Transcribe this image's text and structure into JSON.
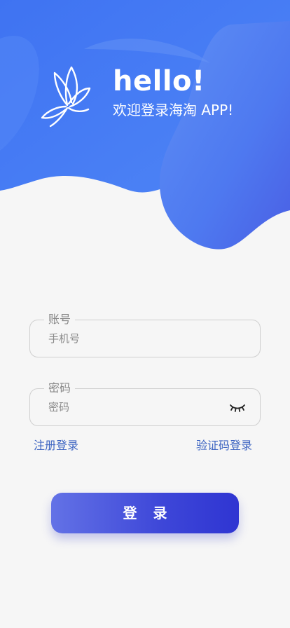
{
  "header": {
    "hello": "hello!",
    "welcome": "欢迎登录海淘 APP!"
  },
  "form": {
    "account": {
      "legend": "账号",
      "placeholder": "手机号",
      "value": ""
    },
    "password": {
      "legend": "密码",
      "placeholder": "密码",
      "value": "",
      "toggle_icon": "eye-closed-icon"
    }
  },
  "links": {
    "register_login": "注册登录",
    "code_login": "验证码登录"
  },
  "login_button": {
    "label": "登 录"
  },
  "colors": {
    "header_blue": "#4f7ef3",
    "link_blue": "#3f66c2",
    "button_start": "#6372e6",
    "button_end": "#2f35d2",
    "background": "#f6f6f6"
  }
}
